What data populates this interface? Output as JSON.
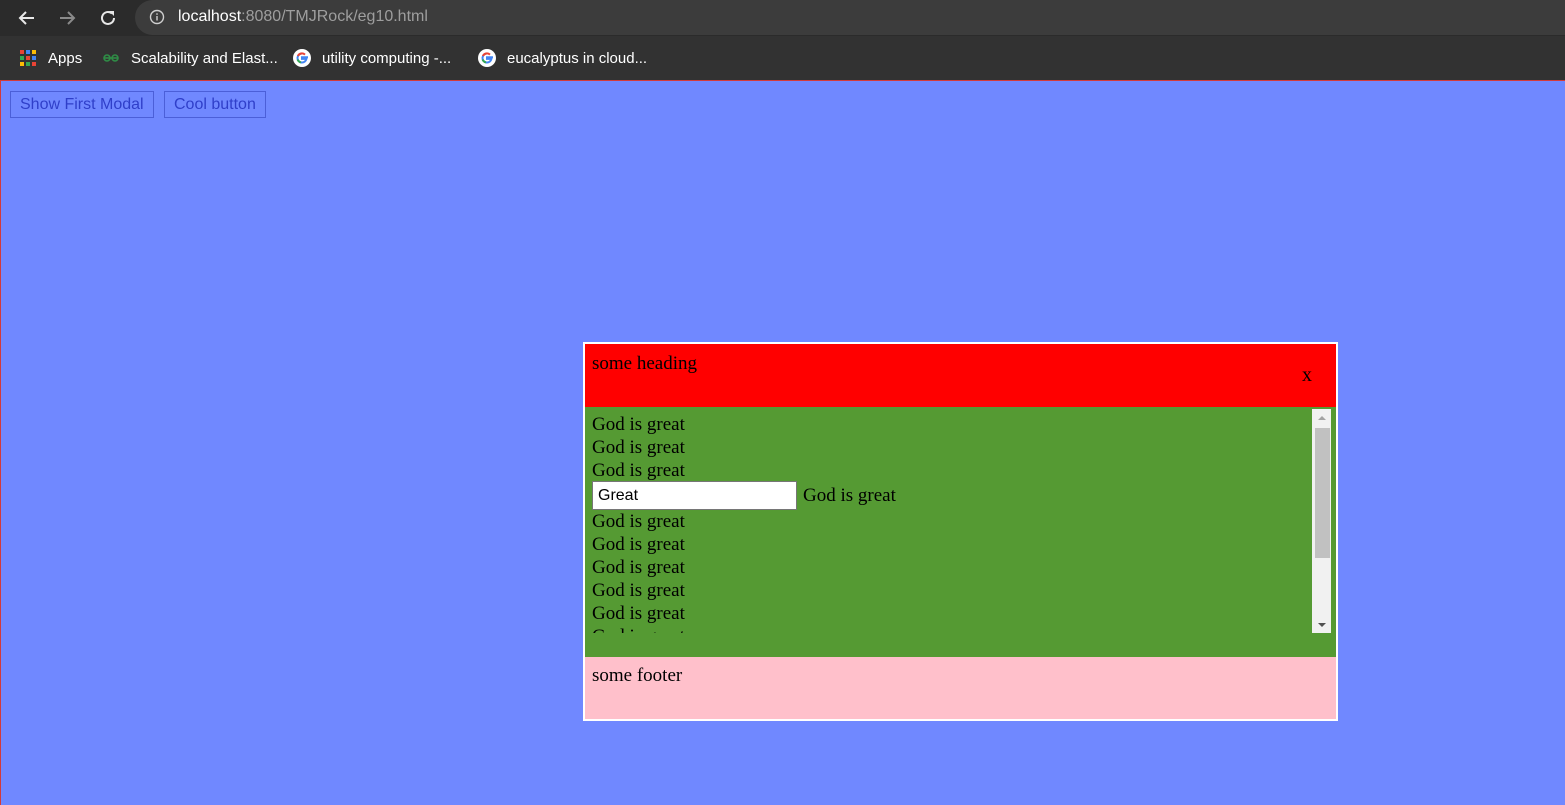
{
  "browser": {
    "url_host": "localhost",
    "url_rest": ":8080/TMJRock/eg10.html",
    "bookmarks": [
      {
        "label": "Apps",
        "icon": "apps-grid-icon"
      },
      {
        "label": "Scalability and Elast...",
        "icon": "geeksforgeeks-icon"
      },
      {
        "label": "utility computing -...",
        "icon": "google-icon"
      },
      {
        "label": "eucalyptus in cloud...",
        "icon": "google-icon"
      }
    ]
  },
  "page": {
    "buttons": {
      "show_first_modal": "Show First Modal",
      "cool_button": "Cool button"
    },
    "background_color": "#7088ff"
  },
  "modal": {
    "heading": "some heading",
    "close_label": "x",
    "header_color": "#ff0000",
    "body_color": "#559a33",
    "footer_color": "#ffc0cb",
    "body_lines": [
      "God is great",
      "God is great",
      "God is great",
      "God is great",
      "God is great",
      "God is great",
      "God is great",
      "God is great",
      "God is great"
    ],
    "input_value": "Great",
    "input_line_text": "God is great",
    "footer": "some footer"
  }
}
